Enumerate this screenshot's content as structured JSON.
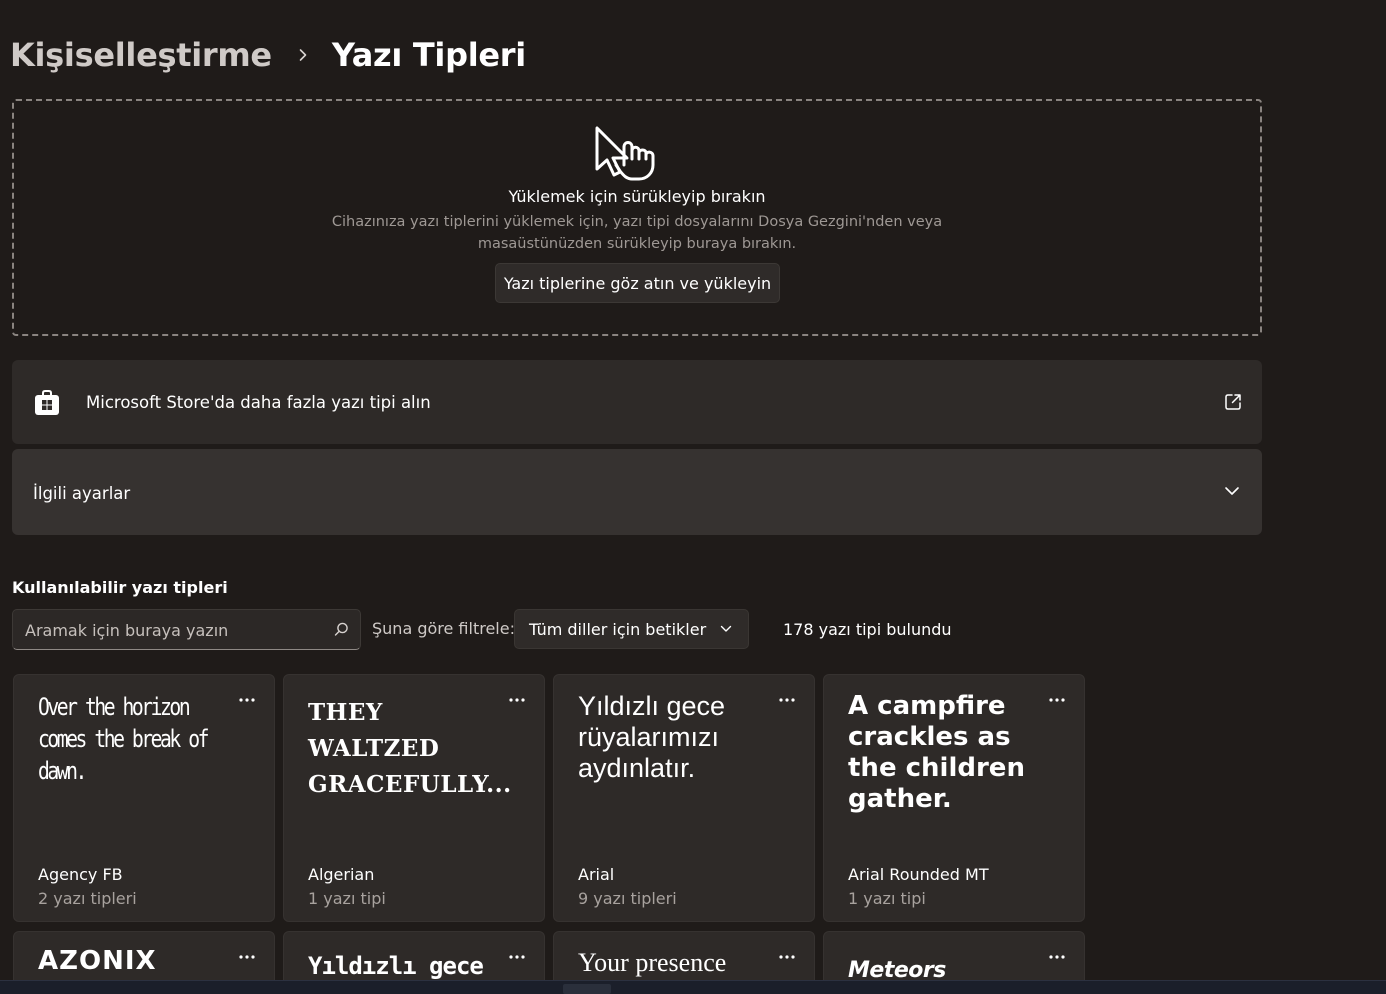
{
  "breadcrumb": {
    "parent": "Kişiselleştirme",
    "current": "Yazı Tipleri"
  },
  "dropzone": {
    "title": "Yüklemek için sürükleyip bırakın",
    "description": "Cihazınıza yazı tiplerini yüklemek için, yazı tipi dosyalarını Dosya Gezgini'nden veya masaüstünüzden sürükleyip buraya bırakın.",
    "browse_button": "Yazı tiplerine göz atın ve yükleyin"
  },
  "store_link": {
    "label": "Microsoft Store'da daha fazla yazı tipi alın"
  },
  "related": {
    "label": "İlgili ayarlar"
  },
  "available": {
    "title": "Kullanılabilir yazı tipleri",
    "search_placeholder": "Aramak için buraya yazın",
    "filter_label": "Şuna göre filtrele:",
    "filter_value": "Tüm diller için betikler",
    "count_text": "178 yazı tipi bulundu"
  },
  "tiles": [
    {
      "sample": "Over the horizon comes the break of dawn.",
      "name": "Agency FB",
      "count": "2 yazı tipleri"
    },
    {
      "sample": "THEY WALTZED GRACEFULLY...",
      "name": "Algerian",
      "count": "1 yazı tipi"
    },
    {
      "sample": "Yıldızlı gece rüyalarımızı aydınlatır.",
      "name": "Arial",
      "count": "9 yazı tipleri"
    },
    {
      "sample": "A campfire crackles as the children gather.",
      "name": "Arial Rounded MT",
      "count": "1 yazı tipi"
    },
    {
      "sample": "AZONIX"
    },
    {
      "sample": "Yıldızlı gece"
    },
    {
      "sample": "Your presence"
    },
    {
      "sample": "Meteors"
    }
  ],
  "colors": {
    "background": "#1f1b19",
    "card": "#2e2a28",
    "secondary_text": "#a8a29e"
  }
}
